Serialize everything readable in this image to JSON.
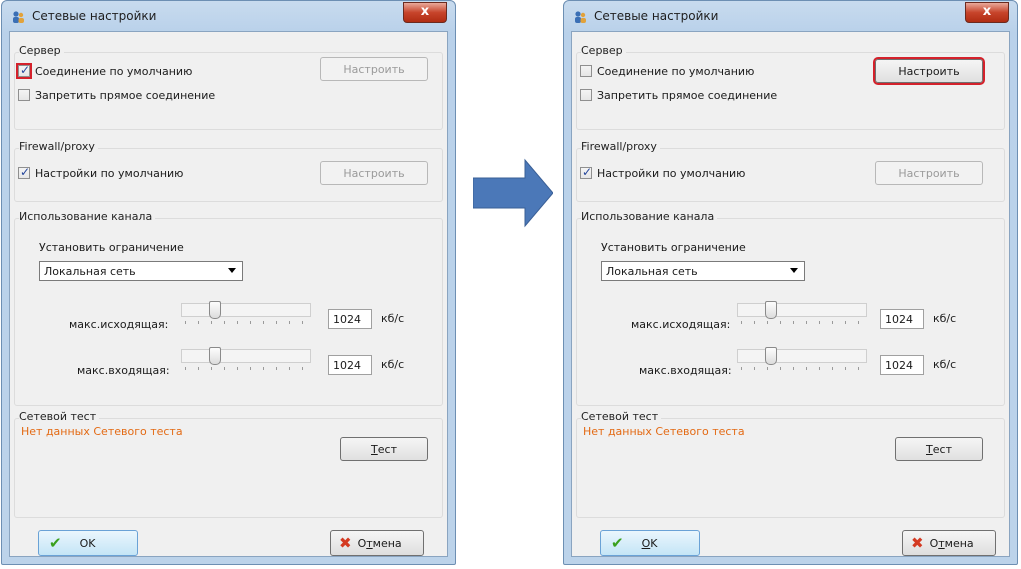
{
  "windows": [
    {
      "title": "Сетевые настройки",
      "close_label": "x",
      "server": {
        "title": "Сервер",
        "default_connection": {
          "label": "Соединение по умолчанию",
          "checked": true,
          "highlighted": true
        },
        "forbid_direct": {
          "label": "Запретить прямое соединение",
          "checked": false
        },
        "configure": {
          "label": "Настроить",
          "enabled": false,
          "highlighted": false
        }
      },
      "firewall": {
        "title": "Firewall/proxy",
        "defaults": {
          "label": "Настройки по умолчанию",
          "checked": true
        },
        "configure": {
          "label": "Настроить",
          "enabled": false
        }
      },
      "channel": {
        "title": "Использование канала",
        "limit_label": "Установить ограничение",
        "limit_value": "Локальная сеть",
        "out_label": "макс.исходящая:",
        "out_value": "1024",
        "in_label": "макс.входящая:",
        "in_value": "1024",
        "unit": "кб/с"
      },
      "test": {
        "title": "Сетевой тест",
        "status": "Нет данных Сетевого теста",
        "button_first": "Т",
        "button_rest": "ест"
      },
      "ok": {
        "first": "",
        "rest": "OK"
      },
      "cancel": {
        "prefix": "О",
        "underlined": "т",
        "rest": "мена"
      }
    },
    {
      "title": "Сетевые настройки",
      "close_label": "x",
      "server": {
        "title": "Сервер",
        "default_connection": {
          "label": "Соединение по умолчанию",
          "checked": false,
          "highlighted": false
        },
        "forbid_direct": {
          "label": "Запретить прямое соединение",
          "checked": false
        },
        "configure": {
          "label": "Настроить",
          "enabled": true,
          "highlighted": true
        }
      },
      "firewall": {
        "title": "Firewall/proxy",
        "defaults": {
          "label": "Настройки по умолчанию",
          "checked": true
        },
        "configure": {
          "label": "Настроить",
          "enabled": false
        }
      },
      "channel": {
        "title": "Использование канала",
        "limit_label": "Установить ограничение",
        "limit_value": "Локальная сеть",
        "out_label": "макс.исходящая:",
        "out_value": "1024",
        "in_label": "макс.входящая:",
        "in_value": "1024",
        "unit": "кб/с"
      },
      "test": {
        "title": "Сетевой тест",
        "status": "Нет данных Сетевого теста",
        "button_first": "Т",
        "button_rest": "ест"
      },
      "ok": {
        "first": "O",
        "rest": "K"
      },
      "cancel": {
        "prefix": "О",
        "underlined": "т",
        "rest": "мена"
      }
    }
  ],
  "colors": {
    "highlight": "#d4212b",
    "status_text": "#e36a14",
    "arrow": "#4b78b8"
  },
  "icons": {
    "app": "users-icon",
    "ok": "checkmark-icon",
    "cancel": "red-x-icon",
    "transition": "right-arrow-icon"
  }
}
